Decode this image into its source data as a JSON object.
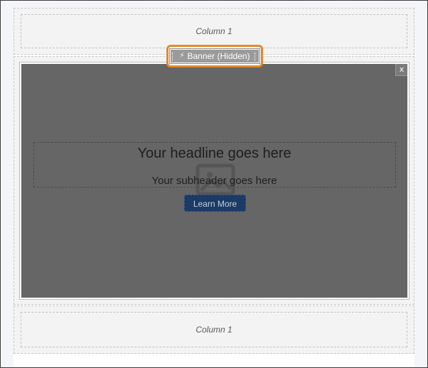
{
  "sections": {
    "top": {
      "column_label": "Column 1"
    },
    "bottom": {
      "column_label": "Column 1"
    }
  },
  "banner_label": {
    "icon": "lightning-bolt-icon",
    "text": "Banner (Hidden)"
  },
  "banner": {
    "close_label": "x",
    "headline": "Your headline goes here",
    "subheader": "Your subheader goes here",
    "image_placeholder_icon": "image-placeholder-icon",
    "cta_label": "Learn More"
  },
  "colors": {
    "highlight": "#e08a2c",
    "banner_bg": "#666666",
    "cta_bg": "#1b3a66"
  }
}
